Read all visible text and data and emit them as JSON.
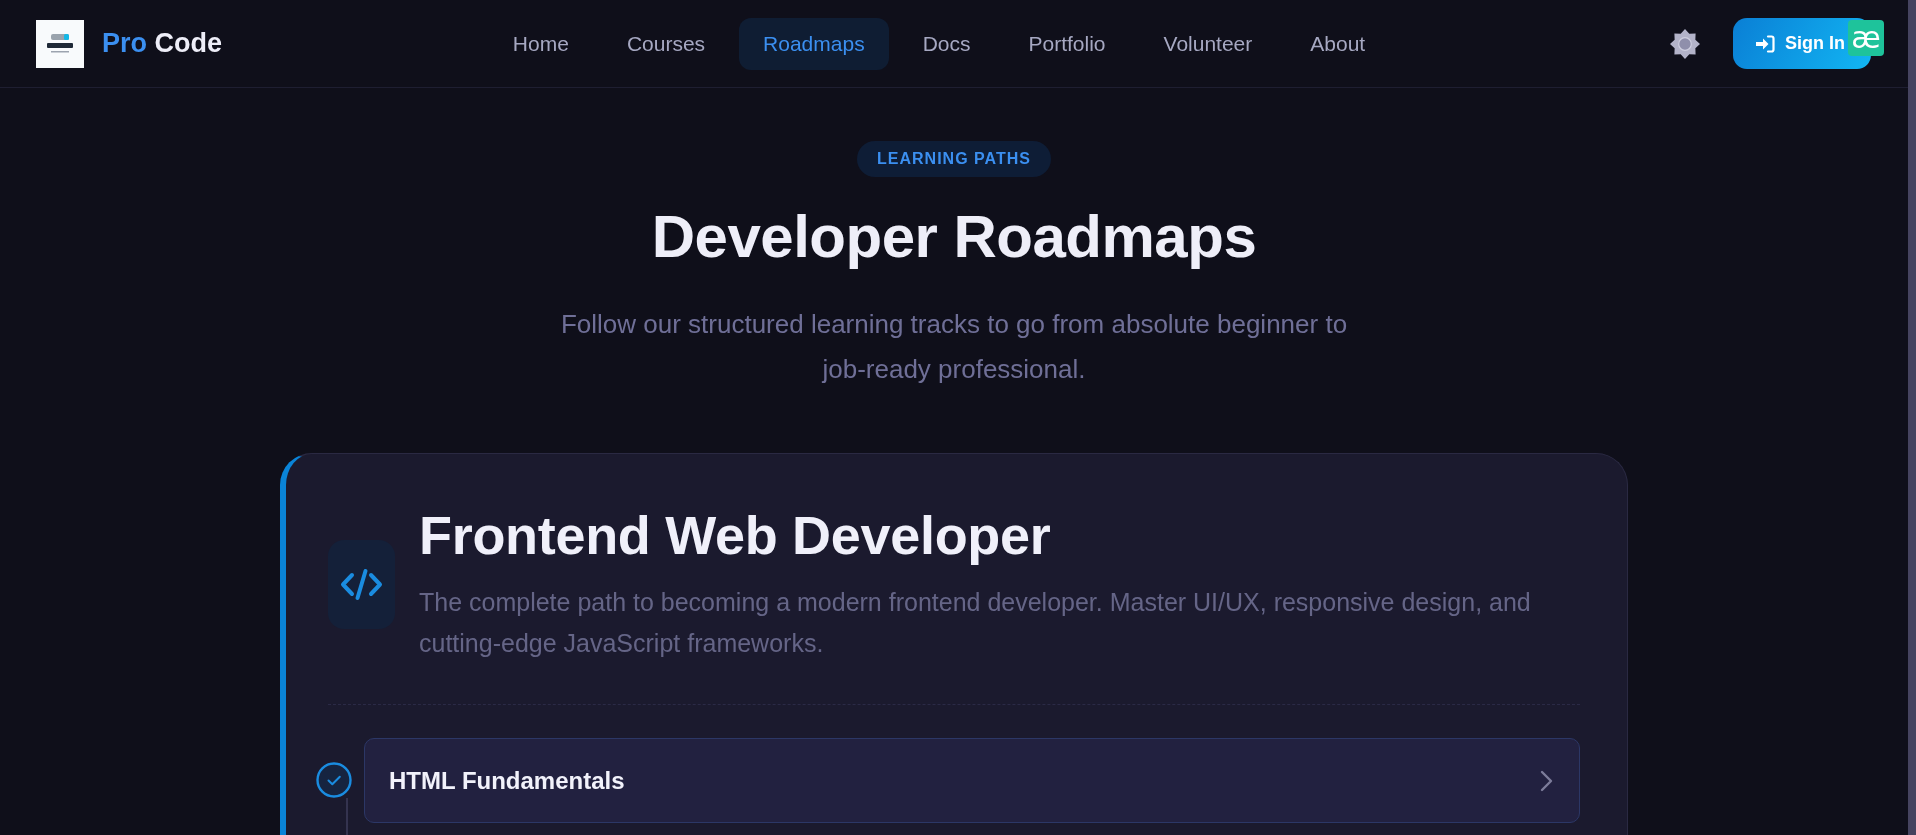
{
  "header": {
    "brand": {
      "accent": "Pro",
      "name": "Code"
    },
    "nav": [
      {
        "label": "Home",
        "selected": false
      },
      {
        "label": "Courses",
        "selected": false
      },
      {
        "label": "Roadmaps",
        "selected": true
      },
      {
        "label": "Docs",
        "selected": false
      },
      {
        "label": "Portfolio",
        "selected": false
      },
      {
        "label": "Volunteer",
        "selected": false
      },
      {
        "label": "About",
        "selected": false
      }
    ],
    "sign_in": "Sign In",
    "extension_badge": "æ"
  },
  "hero": {
    "badge": "LEARNING PATHS",
    "title": "Developer Roadmaps",
    "subtitle": "Follow our structured learning tracks to go from absolute beginner to job-ready professional."
  },
  "roadmaps": [
    {
      "title": "Frontend Web Developer",
      "description": "The complete path to becoming a modern frontend developer. Master UI/UX, responsive design, and cutting-edge JavaScript frameworks.",
      "steps": [
        {
          "title": "HTML Fundamentals",
          "completed": true
        }
      ]
    }
  ]
}
